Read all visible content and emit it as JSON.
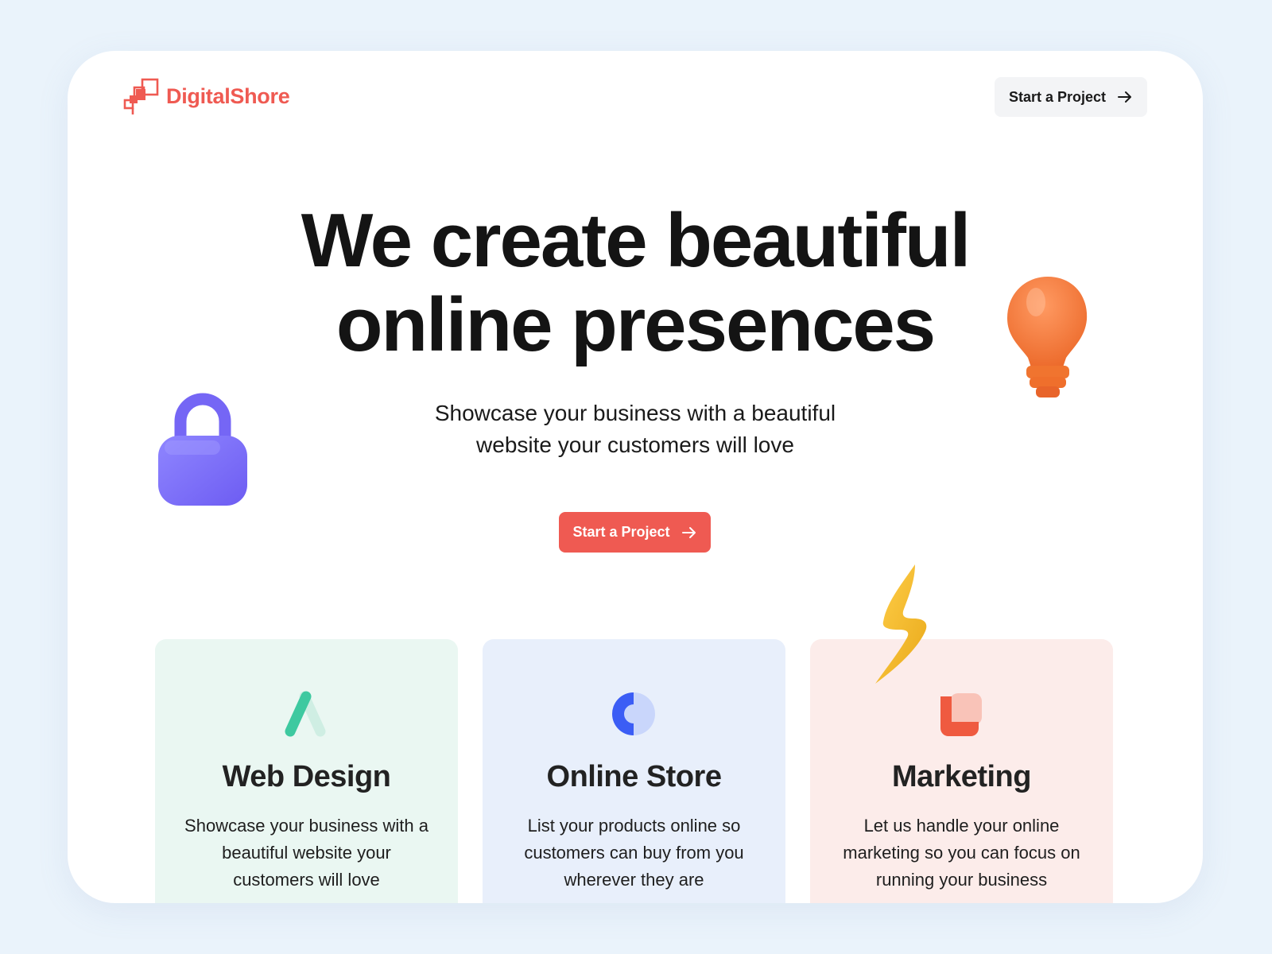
{
  "brand": {
    "name": "DigitalShore",
    "accent_color": "#ef5a52",
    "logo_icon": "stair-squares-logo"
  },
  "header": {
    "cta_label": "Start a Project",
    "cta_icon": "arrow-right-icon"
  },
  "hero": {
    "title_lines": [
      "We create beautiful",
      "online presences"
    ],
    "subtitle_lines": [
      "Showcase your business with a beautiful",
      "website your customers will love"
    ],
    "cta_label": "Start a Project",
    "cta_color": "#ef5a52",
    "decorations": [
      "lock-icon",
      "lightbulb-icon",
      "lightning-bolt-icon"
    ]
  },
  "services": [
    {
      "title": "Web Design",
      "description_lines": [
        "Showcase your business with a",
        "beautiful website your",
        "customers will love"
      ],
      "icon": "web-design-icon",
      "bg_color": "#eaf7f2",
      "icon_color": "#3ec9a0"
    },
    {
      "title": "Online Store",
      "description_lines": [
        "List your products online so",
        "customers can buy from you",
        "wherever they are"
      ],
      "icon": "online-store-icon",
      "bg_color": "#e8effb",
      "icon_color": "#3b5df5"
    },
    {
      "title": "Marketing",
      "description_lines": [
        "Let us handle your online",
        "marketing so you can focus on",
        "running your business"
      ],
      "icon": "marketing-icon",
      "bg_color": "#fcecea",
      "icon_color": "#ef5a40"
    }
  ]
}
